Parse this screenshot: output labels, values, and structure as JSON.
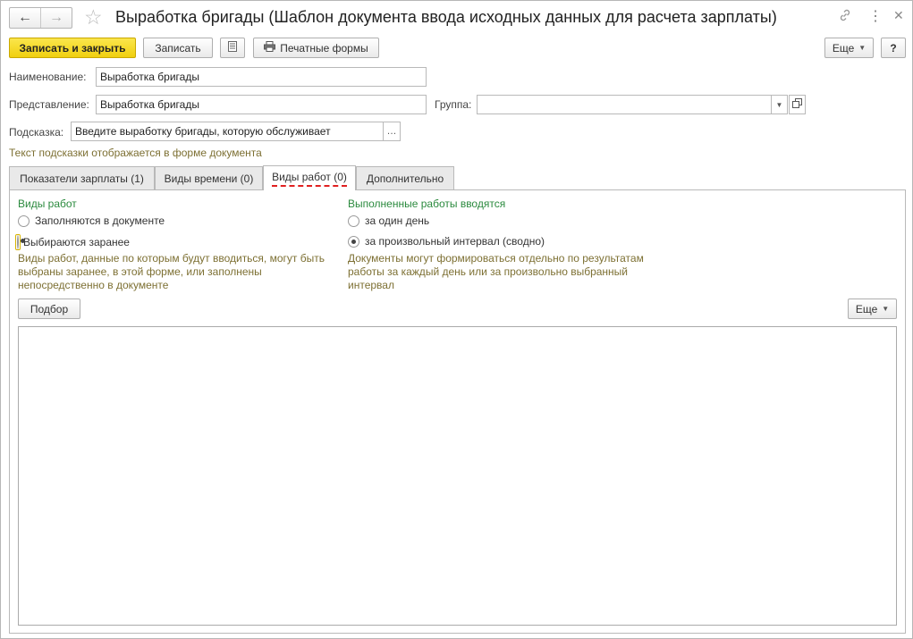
{
  "window": {
    "title": "Выработка бригады (Шаблон документа ввода исходных данных для расчета зарплаты)"
  },
  "toolbar": {
    "save_close": "Записать и закрыть",
    "save": "Записать",
    "print_forms": "Печатные формы",
    "more": "Еще",
    "help": "?"
  },
  "fields": {
    "name_label": "Наименование:",
    "name_value": "Выработка бригады",
    "presentation_label": "Представление:",
    "presentation_value": "Выработка бригады",
    "group_label": "Группа:",
    "group_value": "",
    "hint_label": "Подсказка:",
    "hint_value": "Введите выработку бригады, которую обслуживает",
    "hint_note": "Текст подсказки отображается в форме документа"
  },
  "tabs": [
    {
      "label": "Показатели зарплаты (1)"
    },
    {
      "label": "Виды времени (0)"
    },
    {
      "label": "Виды работ (0)"
    },
    {
      "label": "Дополнительно"
    }
  ],
  "work_types": {
    "title": "Виды работ",
    "options": [
      {
        "label": "Заполняются в документе",
        "selected": false
      },
      {
        "label": "Выбираются заранее",
        "selected": true
      }
    ],
    "description": [
      "Виды работ, данные по которым будут вводиться, могут быть",
      "выбраны заранее, в этой форме, или заполнены",
      "непосредственно в документе"
    ]
  },
  "performed_work": {
    "title": "Выполненные работы вводятся",
    "options": [
      {
        "label": "за один день",
        "selected": false
      },
      {
        "label": "за произвольный интервал (сводно)",
        "selected": true
      }
    ],
    "description": [
      "Документы могут формироваться отдельно по результатам",
      "работы за каждый день или за произвольно выбранный",
      "интервал"
    ]
  },
  "table_toolbar": {
    "pick": "Подбор",
    "more": "Еще"
  },
  "colors": {
    "primary_button": "#f0cf0f",
    "section_title": "#2b8a3e",
    "note_text": "#7d7033",
    "active_tab_underline": "#e02020"
  }
}
